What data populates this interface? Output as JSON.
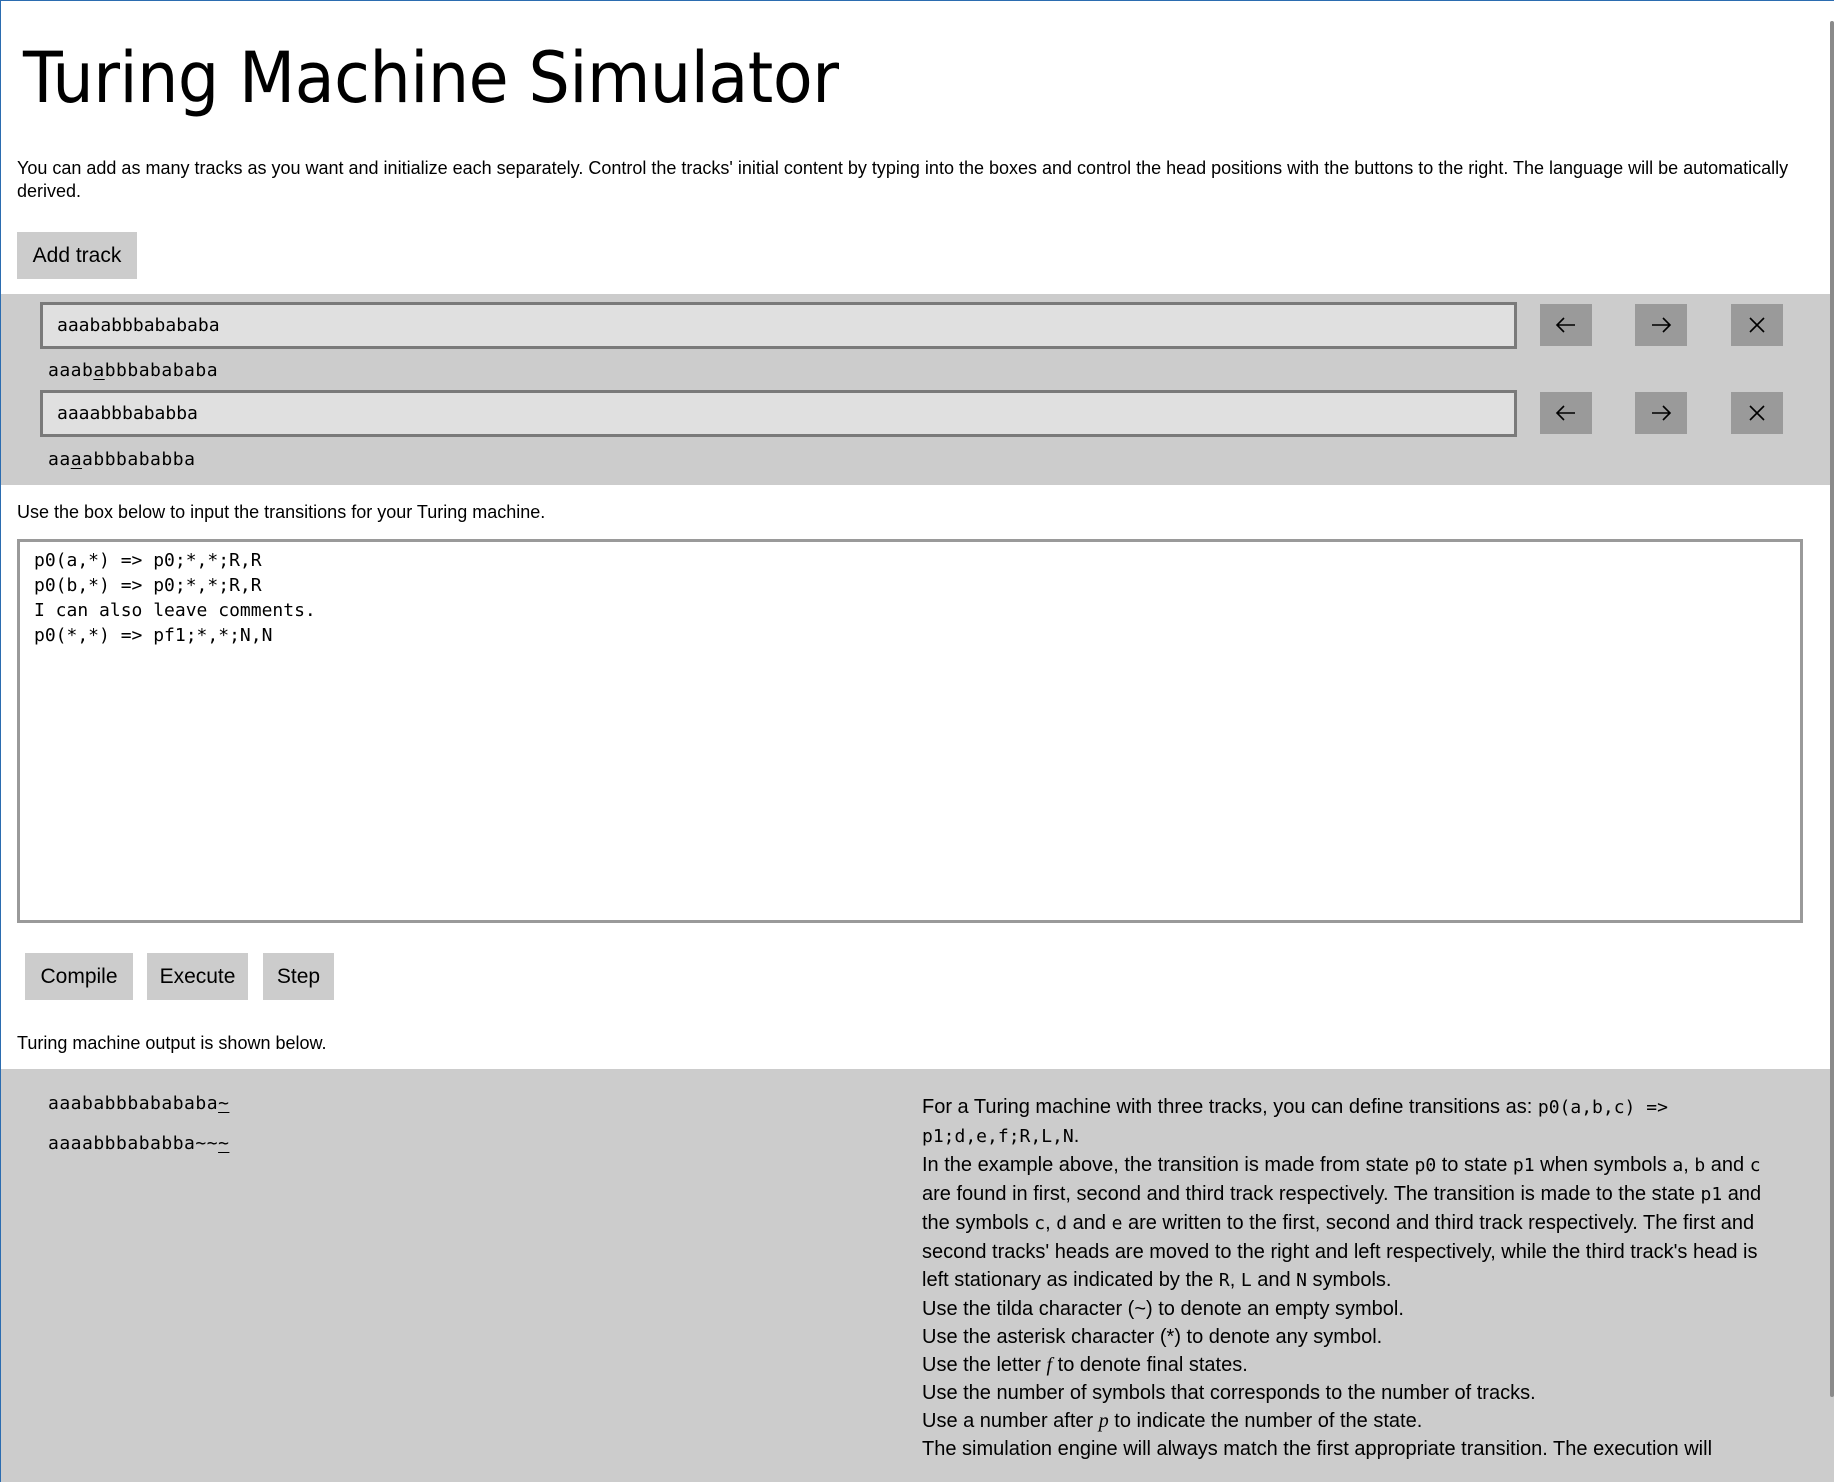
{
  "title": "Turing Machine Simulator",
  "intro": "You can add as many tracks as you want and initialize each separately. Control the tracks' initial content by typing into the boxes and control the head positions with the buttons to the right. The language will be automatically derived.",
  "add_track_label": "Add track",
  "tracks": [
    {
      "input": "aaababbbabababa",
      "display_before": "aaab",
      "display_head": "a",
      "display_after": "bbbabababa"
    },
    {
      "input": "aaaabbbababba",
      "display_before": "aa",
      "display_head": "a",
      "display_after": "abbbababba"
    }
  ],
  "transitions_label": "Use the box below to input the transitions for your Turing machine.",
  "transitions_text": "p0(a,*) => p0;*,*;R,R\np0(b,*) => p0;*,*;R,R\nI can also leave comments.\np0(*,*) => pf1;*,*;N,N",
  "buttons": {
    "compile": "Compile",
    "execute": "Execute",
    "step": "Step"
  },
  "output_label": "Turing machine output is shown below.",
  "output": [
    {
      "before": "aaababbbabababa",
      "head": "~"
    },
    {
      "before": "aaaabbbababba~~",
      "head": "~"
    }
  ],
  "help": {
    "p1_a": "For a Turing machine with three tracks, you can define transitions as: ",
    "p1_code": "p0(a,b,c) => p1;d,e,f;R,L,N",
    "p1_end": ".",
    "p2_a": "In the example above, the transition is made from state ",
    "p2_c1": "p0",
    "p2_b": " to state ",
    "p2_c2": "p1",
    "p2_c": " when symbols ",
    "p2_c3": "a",
    "p2_d": ", ",
    "p2_c4": "b",
    "p2_e": " and ",
    "p2_c5": "c",
    "p2_f": " are found in first, second and third track respectively. The transition is made to the state ",
    "p2_c6": "p1",
    "p2_g": " and the symbols ",
    "p2_c7": "c",
    "p2_h": ", ",
    "p2_c8": "d",
    "p2_i": " and ",
    "p2_c9": "e",
    "p2_j": " are written to the first, second and third track respectively. The first and second tracks' heads are moved to the right and left respectively, while the third track's head is left stationary as indicated by the ",
    "p2_c10": "R",
    "p2_k": ", ",
    "p2_c11": "L",
    "p2_l": " and ",
    "p2_c12": "N",
    "p2_m": " symbols.",
    "p3": "Use the tilda character (~) to denote an empty symbol.",
    "p4": "Use the asterisk character (*) to denote any symbol.",
    "p5_a": "Use the letter ",
    "p5_em": "f",
    "p5_b": " to denote final states.",
    "p6": "Use the number of symbols that corresponds to the number of tracks.",
    "p7_a": "Use a number after ",
    "p7_em": "p",
    "p7_b": " to indicate the number of the state.",
    "p8": "The simulation engine will always match the first appropriate transition. The execution will"
  },
  "icons": {
    "left": "arrow-left-icon",
    "right": "arrow-right-icon",
    "close": "close-icon"
  }
}
